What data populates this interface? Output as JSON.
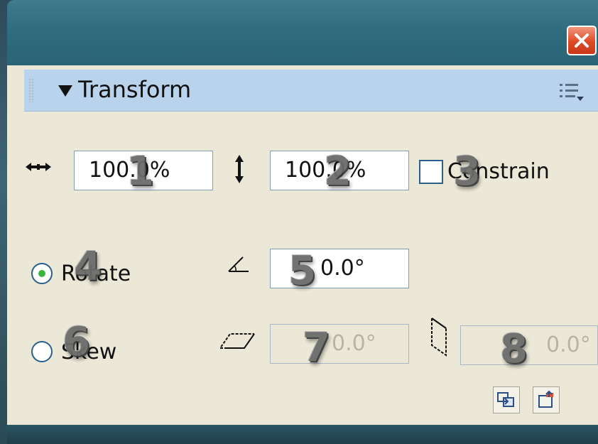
{
  "window": {
    "close_icon": "close-icon"
  },
  "panel": {
    "title": "Transform",
    "options_icon": "panel-options-icon"
  },
  "scale": {
    "width_value": "100.0%",
    "height_value": "100.0%",
    "constrain_label": "Constrain",
    "constrain_checked": false
  },
  "rotate": {
    "label": "Rotate",
    "selected": true,
    "value": "0.0°"
  },
  "skew": {
    "label": "Skew",
    "selected": false,
    "horizontal_value": "0.0°",
    "vertical_value": "0.0°"
  },
  "callouts": [
    "1",
    "2",
    "3",
    "4",
    "5",
    "6",
    "7",
    "8"
  ],
  "buttons": {
    "copy_transform_icon": "copy-and-apply-transform-icon",
    "reset_icon": "reset-transform-icon"
  },
  "colors": {
    "header_bg": "#b9d3ed",
    "panel_bg": "#ece8d8",
    "close_red": "#dd4a25",
    "titlebar": "#2f6b7e"
  }
}
